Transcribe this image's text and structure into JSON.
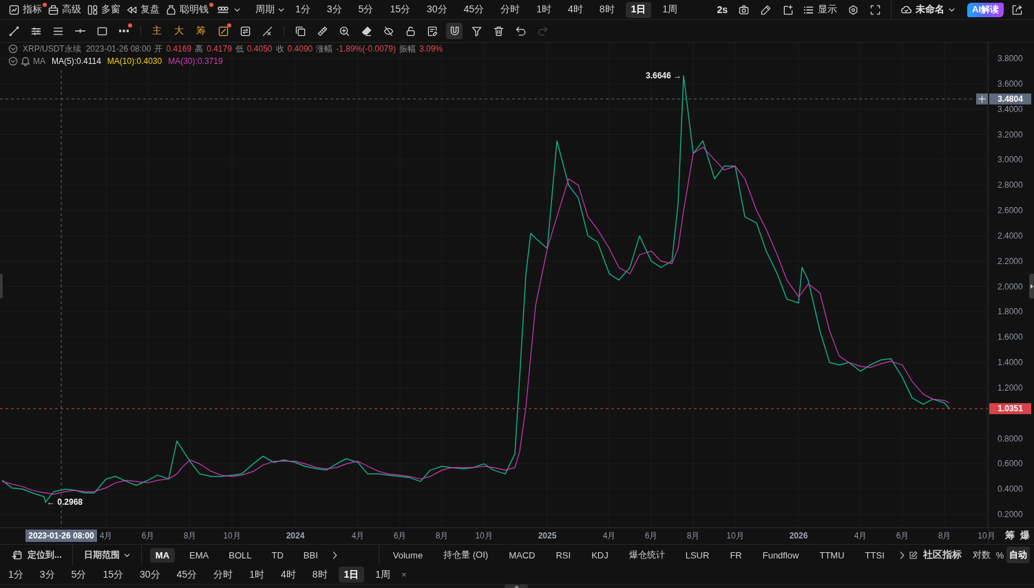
{
  "top_bar": {
    "menus": [
      {
        "label": "指标",
        "notification": true
      },
      {
        "label": "高级",
        "notification": false
      },
      {
        "label": "多窗",
        "notification": false
      },
      {
        "label": "复盘",
        "notification": false
      },
      {
        "label": "聪明钱",
        "notification": true
      }
    ],
    "period_menu": "周期",
    "intervals": [
      {
        "label": "1分",
        "selected": false
      },
      {
        "label": "3分",
        "selected": false
      },
      {
        "label": "5分",
        "selected": false
      },
      {
        "label": "15分",
        "selected": false
      },
      {
        "label": "30分",
        "selected": false
      },
      {
        "label": "45分",
        "selected": false
      },
      {
        "label": "分时",
        "selected": false
      },
      {
        "label": "1时",
        "selected": false
      },
      {
        "label": "4时",
        "selected": false
      },
      {
        "label": "8时",
        "selected": false
      },
      {
        "label": "1日",
        "selected": true
      },
      {
        "label": "1周",
        "selected": false
      }
    ],
    "refresh": "2s",
    "display": "显示",
    "layout_name": "未命名",
    "ai_button": "AI解读"
  },
  "tool_bar": {
    "groups": [
      [
        {
          "notification": false
        },
        {
          "notification": false
        },
        {
          "notification": false
        },
        {
          "notification": false
        },
        {
          "notification": false
        },
        {
          "notification": true
        }
      ],
      [
        {
          "kind": "text",
          "label": "主",
          "on": true,
          "notification": false
        },
        {
          "kind": "text",
          "label": "大",
          "on": true,
          "notification": false
        },
        {
          "kind": "text",
          "label": "筹",
          "on": true,
          "notification": false
        },
        {
          "kind": "icon",
          "on": true,
          "notification": true
        },
        {
          "kind": "icon",
          "on": false,
          "notification": false
        },
        {
          "kind": "icon",
          "on": false,
          "notification": false
        }
      ],
      [
        {
          "selected": false,
          "disabled": false
        },
        {
          "selected": false,
          "disabled": false
        },
        {
          "selected": false,
          "disabled": false
        },
        {
          "selected": false,
          "disabled": false
        },
        {
          "selected": false,
          "disabled": false
        },
        {
          "selected": false,
          "disabled": false
        },
        {
          "selected": false,
          "disabled": false
        },
        {
          "selected": true,
          "disabled": false
        },
        {
          "selected": false,
          "disabled": false
        },
        {
          "selected": false,
          "disabled": false
        },
        {
          "selected": false,
          "disabled": false
        },
        {
          "selected": false,
          "disabled": true
        }
      ]
    ]
  },
  "chart": {
    "legend": {
      "symbol": "XRP/USDT永续",
      "time": "2023-01-26 08:00",
      "fields": [
        {
          "label": "开",
          "value": "0.4169"
        },
        {
          "label": "高",
          "value": "0.4179"
        },
        {
          "label": "低",
          "value": "0.4050"
        },
        {
          "label": "收",
          "value": "0.4090"
        },
        {
          "label": "涨幅",
          "value": "-1.89%(-0.0079)"
        },
        {
          "label": "振幅",
          "value": "3.09%"
        }
      ],
      "indicator": "MA",
      "averages": [
        {
          "text": "MA(5):0.4114",
          "color": "#e6e6e6"
        },
        {
          "text": "MA(10):0.4030",
          "color": "#f2d31b"
        },
        {
          "text": "MA(30):0.3719",
          "color": "#d03ab8"
        }
      ]
    },
    "chart_data": {
      "type": "line",
      "x": [
        "2022-11-01",
        "2022-11-15",
        "2022-12-01",
        "2022-12-15",
        "2023-01-01",
        "2023-01-03",
        "2023-01-15",
        "2023-02-01",
        "2023-02-15",
        "2023-03-01",
        "2023-03-15",
        "2023-04-01",
        "2023-04-15",
        "2023-05-01",
        "2023-05-15",
        "2023-06-01",
        "2023-06-15",
        "2023-07-01",
        "2023-07-13",
        "2023-07-20",
        "2023-08-01",
        "2023-08-15",
        "2023-09-01",
        "2023-09-15",
        "2023-10-01",
        "2023-10-15",
        "2023-11-01",
        "2023-11-15",
        "2023-12-01",
        "2023-12-15",
        "2024-01-01",
        "2024-01-15",
        "2024-02-01",
        "2024-02-15",
        "2024-03-01",
        "2024-03-15",
        "2024-04-01",
        "2024-04-15",
        "2024-05-01",
        "2024-05-15",
        "2024-06-01",
        "2024-06-15",
        "2024-07-01",
        "2024-07-15",
        "2024-08-01",
        "2024-08-15",
        "2024-09-01",
        "2024-09-15",
        "2024-10-01",
        "2024-10-15",
        "2024-11-01",
        "2024-11-15",
        "2024-11-22",
        "2024-12-01",
        "2024-12-08",
        "2024-12-15",
        "2025-01-01",
        "2025-01-15",
        "2025-02-01",
        "2025-02-15",
        "2025-03-01",
        "2025-03-15",
        "2025-04-01",
        "2025-04-15",
        "2025-05-01",
        "2025-05-15",
        "2025-06-01",
        "2025-06-15",
        "2025-07-01",
        "2025-07-10",
        "2025-07-18",
        "2025-08-01",
        "2025-08-15",
        "2025-09-01",
        "2025-09-15",
        "2025-10-01",
        "2025-10-15",
        "2025-11-01",
        "2025-11-15",
        "2025-12-01",
        "2025-12-15",
        "2026-01-01",
        "2026-01-06",
        "2026-01-15",
        "2026-02-01",
        "2026-02-15",
        "2026-03-01",
        "2026-03-15",
        "2026-04-01",
        "2026-04-15",
        "2026-05-01",
        "2026-05-15",
        "2026-06-01",
        "2026-06-15",
        "2026-07-01",
        "2026-07-15",
        "2026-08-01",
        "2026-08-08"
      ],
      "series": [
        {
          "color": "#17a884",
          "values": [
            0.47,
            0.41,
            0.4,
            0.37,
            0.34,
            0.2968,
            0.38,
            0.4,
            0.39,
            0.37,
            0.37,
            0.48,
            0.5,
            0.46,
            0.43,
            0.47,
            0.51,
            0.48,
            0.78,
            0.72,
            0.62,
            0.52,
            0.5,
            0.5,
            0.51,
            0.52,
            0.6,
            0.66,
            0.61,
            0.63,
            0.61,
            0.58,
            0.56,
            0.55,
            0.6,
            0.64,
            0.61,
            0.52,
            0.52,
            0.51,
            0.5,
            0.49,
            0.46,
            0.55,
            0.58,
            0.57,
            0.56,
            0.57,
            0.6,
            0.55,
            0.52,
            0.68,
            1.3,
            2.1,
            2.42,
            2.38,
            2.3,
            3.15,
            2.8,
            2.7,
            2.4,
            2.35,
            2.1,
            2.05,
            2.15,
            2.4,
            2.2,
            2.15,
            2.2,
            2.65,
            3.6646,
            3.05,
            3.15,
            2.85,
            2.95,
            2.95,
            2.55,
            2.5,
            2.28,
            2.1,
            1.9,
            1.87,
            2.15,
            2.05,
            1.65,
            1.4,
            1.38,
            1.4,
            1.33,
            1.38,
            1.42,
            1.43,
            1.28,
            1.12,
            1.07,
            1.11,
            1.08,
            1.035
          ]
        },
        {
          "color": "#d03ab8",
          "values": [
            0.46,
            0.44,
            0.42,
            0.39,
            0.37,
            0.37,
            0.36,
            0.38,
            0.39,
            0.38,
            0.38,
            0.41,
            0.45,
            0.47,
            0.46,
            0.45,
            0.47,
            0.48,
            0.52,
            0.57,
            0.63,
            0.6,
            0.54,
            0.51,
            0.5,
            0.51,
            0.54,
            0.59,
            0.62,
            0.62,
            0.62,
            0.6,
            0.57,
            0.56,
            0.57,
            0.6,
            0.62,
            0.58,
            0.54,
            0.52,
            0.51,
            0.5,
            0.48,
            0.5,
            0.55,
            0.57,
            0.57,
            0.57,
            0.58,
            0.57,
            0.55,
            0.57,
            0.7,
            1.05,
            1.45,
            1.85,
            2.3,
            2.55,
            2.85,
            2.8,
            2.55,
            2.45,
            2.3,
            2.15,
            2.1,
            2.25,
            2.28,
            2.2,
            2.18,
            2.3,
            2.6,
            3.05,
            3.1,
            3.0,
            2.92,
            2.95,
            2.85,
            2.6,
            2.45,
            2.25,
            2.05,
            1.92,
            1.95,
            2.02,
            1.95,
            1.65,
            1.45,
            1.4,
            1.37,
            1.36,
            1.39,
            1.41,
            1.38,
            1.25,
            1.15,
            1.11,
            1.1,
            1.08
          ]
        }
      ],
      "xlim": [
        "2022-10-29",
        "2026-12-09"
      ],
      "ylim": [
        0.097,
        3.925
      ],
      "xticks": [
        {
          "value": "2023-04-01",
          "label": "4月"
        },
        {
          "value": "2023-06-01",
          "label": "6月"
        },
        {
          "value": "2023-08-01",
          "label": "8月"
        },
        {
          "value": "2023-10-01",
          "label": "10月"
        },
        {
          "value": "2024-01-01",
          "label": "2024"
        },
        {
          "value": "2024-04-01",
          "label": "4月"
        },
        {
          "value": "2024-06-01",
          "label": "6月"
        },
        {
          "value": "2024-08-01",
          "label": "8月"
        },
        {
          "value": "2024-10-01",
          "label": "10月"
        },
        {
          "value": "2025-01-01",
          "label": "2025"
        },
        {
          "value": "2025-04-01",
          "label": "4月"
        },
        {
          "value": "2025-06-01",
          "label": "6月"
        },
        {
          "value": "2025-08-01",
          "label": "8月"
        },
        {
          "value": "2025-10-01",
          "label": "10月"
        },
        {
          "value": "2026-01-01",
          "label": "2026"
        },
        {
          "value": "2026-04-01",
          "label": "4月"
        },
        {
          "value": "2026-06-01",
          "label": "6月"
        },
        {
          "value": "2026-08-01",
          "label": "8月"
        },
        {
          "value": "2026-10-01",
          "label": "10月"
        }
      ],
      "yticks": [
        {
          "value": 0.2,
          "label": "0.2000"
        },
        {
          "value": 0.4,
          "label": "0.4000"
        },
        {
          "value": 0.6,
          "label": "0.6000"
        },
        {
          "value": 0.8,
          "label": "0.8000"
        },
        {
          "value": 1.2,
          "label": "1.2000"
        },
        {
          "value": 1.4,
          "label": "1.4000"
        },
        {
          "value": 1.6,
          "label": "1.6000"
        },
        {
          "value": 1.8,
          "label": "1.8000"
        },
        {
          "value": 2.0,
          "label": "2.0000"
        },
        {
          "value": 2.2,
          "label": "2.2000"
        },
        {
          "value": 2.4,
          "label": "2.4000"
        },
        {
          "value": 2.6,
          "label": "2.6000"
        },
        {
          "value": 2.8,
          "label": "2.8000"
        },
        {
          "value": 3.0,
          "label": "3.0000"
        },
        {
          "value": 3.2,
          "label": "3.2000"
        },
        {
          "value": 3.4,
          "label": "3.4000"
        },
        {
          "value": 3.6,
          "label": "3.6000"
        },
        {
          "value": 3.8,
          "label": "3.8000"
        }
      ],
      "grid": true,
      "ref_lines": [
        {
          "axis": "y",
          "value": 1.0351,
          "label": "1.0351",
          "color": "#d6434a"
        },
        {
          "axis": "y",
          "value": 3.4804,
          "label": "3.4804",
          "color": "#5f6b7e"
        },
        {
          "axis": "x",
          "value": "2023-01-26",
          "label": "2023-01-26 08:00",
          "color": "#5f6b7e"
        }
      ],
      "annotations": [
        {
          "x": "2025-07-18",
          "y": 3.6646,
          "text": "3.6646 →"
        },
        {
          "x": "2023-01-03",
          "y": 0.2968,
          "text": "← 0.2968"
        }
      ]
    },
    "side_buttons": [
      {
        "label": "筹"
      },
      {
        "label": "爆"
      }
    ]
  },
  "indicator_bar": {
    "locate": "定位到...",
    "date_range": "日期范围",
    "main_indicators": [
      {
        "label": "MA",
        "selected": true
      },
      {
        "label": "EMA",
        "selected": false
      },
      {
        "label": "BOLL",
        "selected": false
      },
      {
        "label": "TD",
        "selected": false
      },
      {
        "label": "BBI",
        "selected": false
      }
    ],
    "sub_indicators": [
      {
        "label": "Volume",
        "selected": false
      },
      {
        "label": "持仓量 (OI)",
        "selected": false
      },
      {
        "label": "MACD",
        "selected": false
      },
      {
        "label": "RSI",
        "selected": false
      },
      {
        "label": "KDJ",
        "selected": false
      },
      {
        "label": "爆仓统计",
        "selected": false
      },
      {
        "label": "LSUR",
        "selected": false
      },
      {
        "label": "FR",
        "selected": false
      },
      {
        "label": "Fundflow",
        "selected": false
      },
      {
        "label": "TTMU",
        "selected": false
      },
      {
        "label": "TTSI",
        "selected": false
      }
    ],
    "community": "社区指标",
    "scale_options": [
      {
        "label": "对数",
        "selected": false
      },
      {
        "label": "%",
        "selected": false
      },
      {
        "label": "自动",
        "selected": true
      }
    ]
  },
  "interval_bar": {
    "intervals": [
      {
        "label": "1分",
        "selected": false
      },
      {
        "label": "3分",
        "selected": false
      },
      {
        "label": "5分",
        "selected": false
      },
      {
        "label": "15分",
        "selected": false
      },
      {
        "label": "30分",
        "selected": false
      },
      {
        "label": "45分",
        "selected": false
      },
      {
        "label": "分时",
        "selected": false
      },
      {
        "label": "1时",
        "selected": false
      },
      {
        "label": "4时",
        "selected": false
      },
      {
        "label": "8时",
        "selected": false
      },
      {
        "label": "1日",
        "selected": true
      },
      {
        "label": "1周",
        "selected": false
      }
    ],
    "close": "×"
  }
}
